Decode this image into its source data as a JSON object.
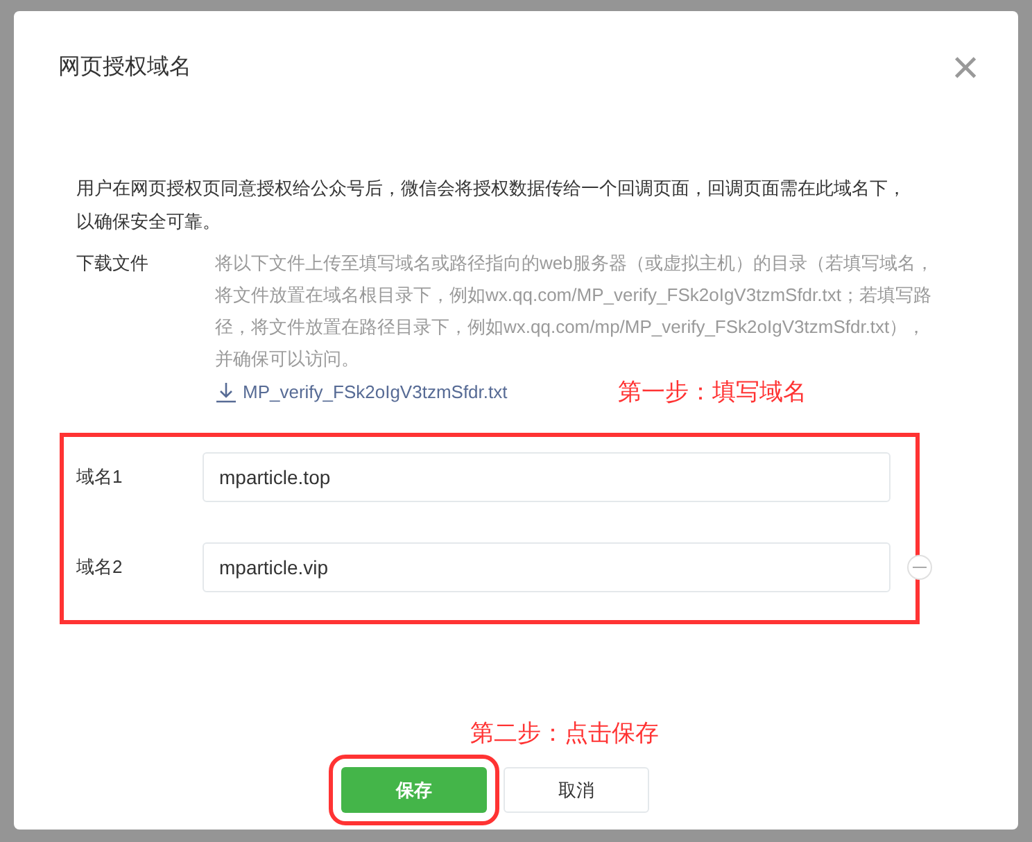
{
  "dialog": {
    "title": "网页授权域名",
    "close": "×",
    "description": "用户在网页授权页同意授权给公众号后，微信会将授权数据传给一个回调页面，回调页面需在此域名下，以确保安全可靠。",
    "download": {
      "label": "下载文件",
      "text": "将以下文件上传至填写域名或路径指向的web服务器（或虚拟主机）的目录（若填写域名，将文件放置在域名根目录下，例如wx.qq.com/MP_verify_FSk2oIgV3tzmSfdr.txt；若填写路径，将文件放置在路径目录下，例如wx.qq.com/mp/MP_verify_FSk2oIgV3tzmSfdr.txt），并确保可以访问。",
      "file": "MP_verify_FSk2oIgV3tzmSfdr.txt"
    },
    "step1": "第一步：填写域名",
    "domains": [
      {
        "label": "域名1",
        "value": "mparticle.top",
        "removable": false
      },
      {
        "label": "域名2",
        "value": "mparticle.vip",
        "removable": true
      }
    ],
    "step2": "第二步：点击保存",
    "buttons": [
      {
        "label": "保存",
        "kind": "primary"
      },
      {
        "label": "取消",
        "kind": "default"
      }
    ]
  }
}
